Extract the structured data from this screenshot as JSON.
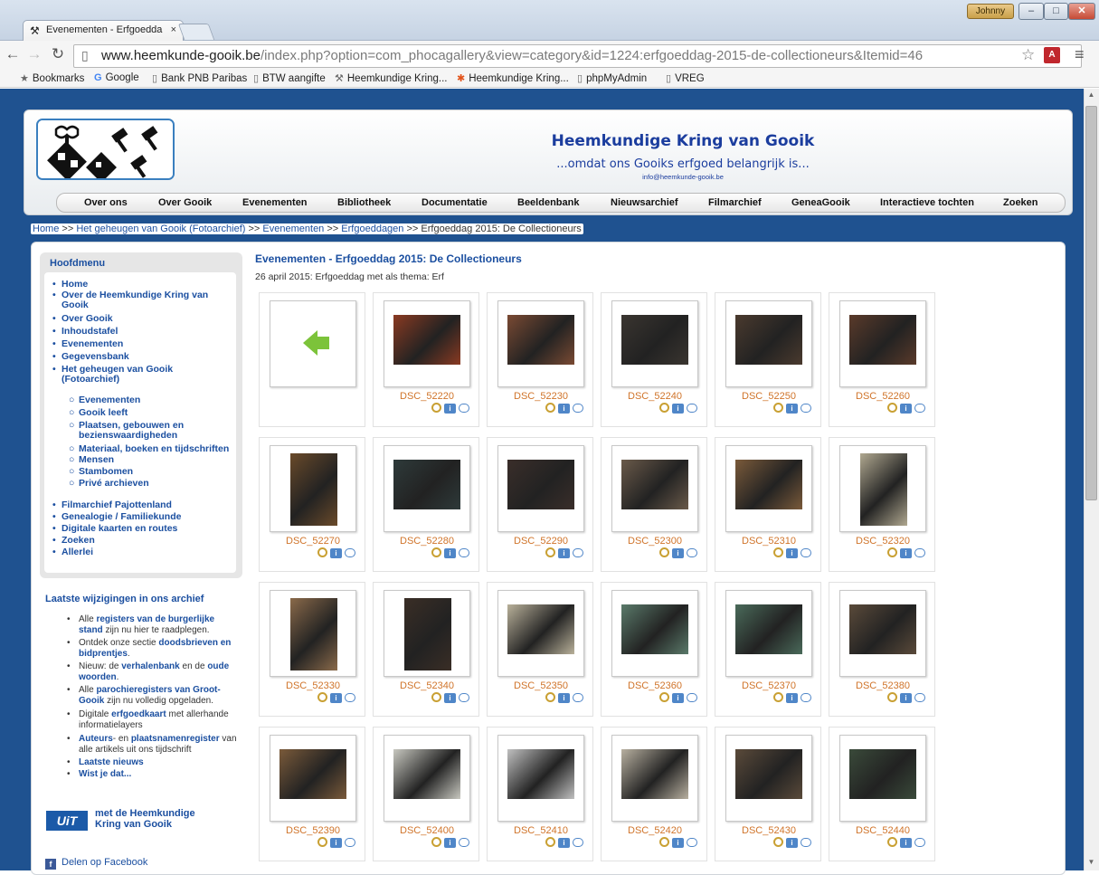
{
  "window": {
    "tab_title": "Evenementen - Erfgoedda",
    "tab_close": "×",
    "user_badge": "Johnny",
    "min": "‒",
    "max": "□",
    "close": "✕"
  },
  "toolbar": {
    "url_host": "www.heemkunde-gooik.be",
    "url_path": "/index.php?option=com_phocagallery&view=category&id=1224:erfgoeddag-2015-de-collectioneurs&Itemid=46"
  },
  "bookmarks": [
    {
      "label": "Bookmarks",
      "icon": "star-icon"
    },
    {
      "label": "Google",
      "icon": "google-icon"
    },
    {
      "label": "Bank PNB Paribas",
      "icon": "page-icon"
    },
    {
      "label": "BTW aangifte",
      "icon": "page-icon"
    },
    {
      "label": "Heemkundige Kring...",
      "icon": "hammers-icon"
    },
    {
      "label": "Heemkundige Kring...",
      "icon": "joomla-icon"
    },
    {
      "label": "phpMyAdmin",
      "icon": "page-icon"
    },
    {
      "label": "VREG",
      "icon": "page-icon"
    }
  ],
  "header": {
    "title": "Heemkundige Kring van Gooik",
    "slogan": "...omdat ons Gooiks erfgoed belangrijk is...",
    "email": "info@heemkunde-gooik.be"
  },
  "nav": [
    "Over ons",
    "Over Gooik",
    "Evenementen",
    "Bibliotheek",
    "Documentatie",
    "Beeldenbank",
    "Nieuwsarchief",
    "Filmarchief",
    "GeneaGooik",
    "Interactieve tochten",
    "Zoeken"
  ],
  "breadcrumb": {
    "home": "Home",
    "sep": ">>",
    "l1": "Het geheugen van Gooik (Fotoarchief)",
    "l2": "Evenementen",
    "l3": "Erfgoeddagen",
    "current": "Erfgoeddag 2015: De Collectioneurs"
  },
  "sidebar": {
    "title": "Hoofdmenu",
    "items": [
      "Home",
      "Over de Heemkundige Kring van Gooik",
      "Over Gooik",
      "Inhoudstafel",
      "Evenementen",
      "Gegevensbank",
      "Het geheugen van Gooik (Fotoarchief)"
    ],
    "subitems": [
      "Evenementen",
      "Gooik leeft",
      "Plaatsen, gebouwen en bezienswaardigheden",
      "Materiaal, boeken en tijdschriften",
      "Mensen",
      "Stambomen",
      "Privé archieven"
    ],
    "items2": [
      "Filmarchief Pajottenland",
      "Genealogie / Familiekunde",
      "Digitale kaarten en routes",
      "Zoeken",
      "Allerlei"
    ]
  },
  "latest": {
    "title": "Laatste wijzigingen in ons archief",
    "items": [
      {
        "pre": "Alle ",
        "b": "registers van de burgerlijke stand",
        "post": " zijn nu hier te raadplegen."
      },
      {
        "pre": "Ontdek onze sectie ",
        "b": "doodsbrieven en bidprentjes",
        "post": "."
      },
      {
        "pre": "Nieuw: de ",
        "b": "verhalenbank",
        "post": " en de ",
        "b2": "oude woorden",
        "post2": "."
      },
      {
        "pre": "Alle ",
        "b": "parochieregisters van Groot-Gooik",
        "post": " zijn nu volledig opgeladen."
      },
      {
        "pre": "Digitale ",
        "b": "erfgoedkaart",
        "post": " met allerhande informatielayers"
      },
      {
        "pre": "",
        "b": "Auteurs",
        "post": "- en ",
        "b2": "plaatsnamenregister",
        "post2": " van alle artikels uit ons tijdschrift"
      },
      {
        "pre": "",
        "b": "Laatste nieuws",
        "post": ""
      },
      {
        "pre": "",
        "b": "Wist je dat...",
        "post": ""
      }
    ],
    "uit_logo": "UiT",
    "uit_text": "met de Heemkundige Kring van Gooik",
    "facebook": "Delen op Facebook"
  },
  "gallery": {
    "title": "Evenementen - Erfgoeddag 2015: De Collectioneurs",
    "description": "26 april 2015: Erfgoeddag met als thema: Erf",
    "photos": [
      "DSC_52220",
      "DSC_52230",
      "DSC_52240",
      "DSC_52250",
      "DSC_52260",
      "DSC_52270",
      "DSC_52280",
      "DSC_52290",
      "DSC_52300",
      "DSC_52310",
      "DSC_52320",
      "DSC_52330",
      "DSC_52340",
      "DSC_52350",
      "DSC_52360",
      "DSC_52370",
      "DSC_52380",
      "DSC_52390",
      "DSC_52400",
      "DSC_52410",
      "DSC_52420",
      "DSC_52430",
      "DSC_52440"
    ],
    "photo_tones": [
      "#8a3a22",
      "#7a4a33",
      "#3a3530",
      "#4a3a2e",
      "#5a3a2a",
      "#6a4a2a",
      "#2e3a3a",
      "#3a2e2a",
      "#6a5a4a",
      "#7a5a3a",
      "#b0a890",
      "#8a6a4a",
      "#3a2e26",
      "#b9b19a",
      "#5a7a6a",
      "#4a6a5a",
      "#5a4a3a",
      "#7a5a3a",
      "#c8c8c0",
      "#c0c0c0",
      "#b8b0a0",
      "#5a4a3a",
      "#3a4a3a"
    ]
  }
}
